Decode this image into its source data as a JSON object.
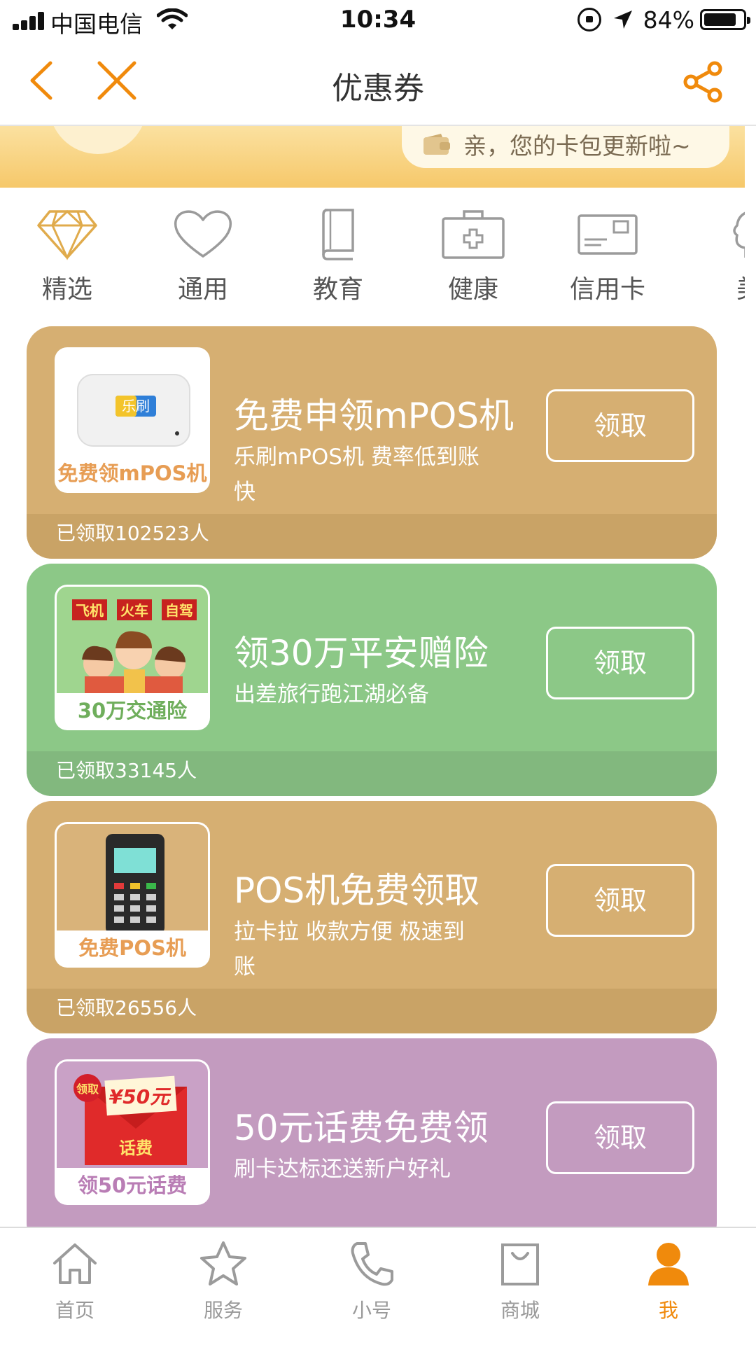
{
  "status_bar": {
    "carrier": "中国电信",
    "time": "10:34",
    "battery_percent": "84%",
    "battery_level": 0.84
  },
  "nav": {
    "title": "优惠券",
    "icons": [
      "back-icon",
      "close-icon",
      "share-icon"
    ]
  },
  "banner": {
    "text": "亲，您的卡包更新啦~"
  },
  "categories": [
    {
      "label": "精选",
      "icon": "diamond-icon",
      "active": true
    },
    {
      "label": "通用",
      "icon": "heart-icon"
    },
    {
      "label": "教育",
      "icon": "book-icon"
    },
    {
      "label": "健康",
      "icon": "medical-kit-icon"
    },
    {
      "label": "信用卡",
      "icon": "credit-card-icon"
    },
    {
      "label": "美",
      "icon": "beauty-icon"
    }
  ],
  "coupons": [
    {
      "thumb_caption": "免费领mPOS机",
      "thumb_brand": "乐刷",
      "title": "免费申领mPOS机",
      "desc": "乐刷mPOS机 费率低到账快",
      "button": "领取",
      "count": "已领取102523人"
    },
    {
      "thumb_caption": "30万交通险",
      "thumb_tags": [
        "飞机",
        "火车",
        "自驾"
      ],
      "title": "领30万平安赠险",
      "desc": "出差旅行跑江湖必备",
      "button": "领取",
      "count": "已领取33145人"
    },
    {
      "thumb_caption": "免费POS机",
      "title": "POS机免费领取",
      "desc": "拉卡拉 收款方便 极速到账",
      "button": "领取",
      "count": "已领取26556人"
    },
    {
      "thumb_caption": "领50元话费",
      "thumb_badge": "领取",
      "thumb_amount": "¥50元",
      "thumb_envelope": "话费",
      "title": "50元话费免费领",
      "desc": "刷卡达标还送新户好礼",
      "button": "领取"
    }
  ],
  "tabbar": [
    {
      "label": "首页",
      "icon": "home-icon"
    },
    {
      "label": "服务",
      "icon": "star-icon"
    },
    {
      "label": "小号",
      "icon": "phone-icon"
    },
    {
      "label": "商城",
      "icon": "shopping-bag-icon"
    },
    {
      "label": "我",
      "icon": "user-icon",
      "active": true
    }
  ],
  "colors": {
    "accent": "#f08a0c",
    "gold_card": "#d6af72",
    "green_card": "#8cc887",
    "purple_card": "#c39bbf"
  }
}
